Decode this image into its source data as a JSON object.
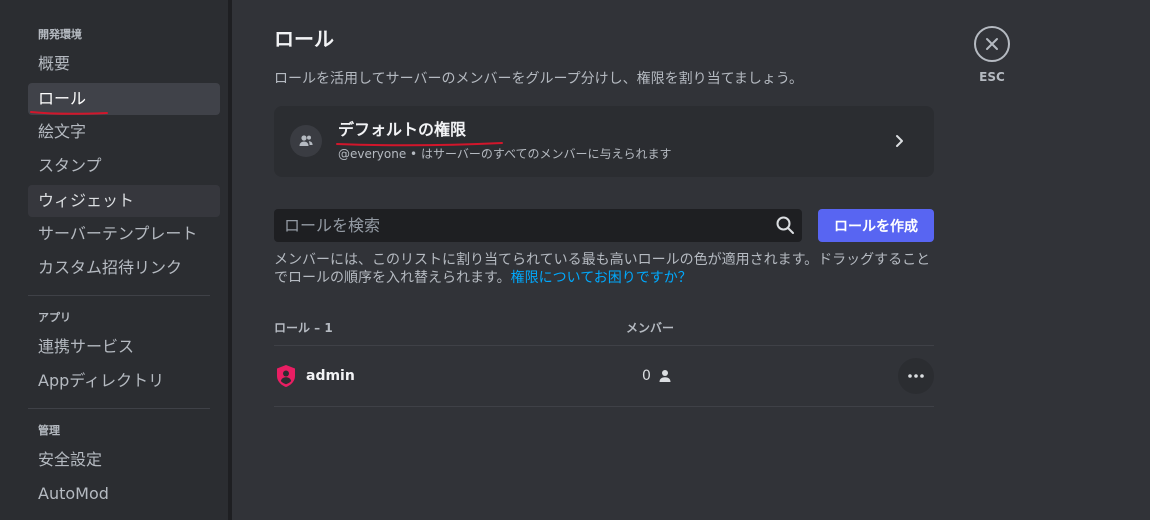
{
  "sidebar": {
    "sections": [
      {
        "header": "開発環境",
        "items": [
          {
            "label": "概要"
          },
          {
            "label": "ロール"
          },
          {
            "label": "絵文字"
          },
          {
            "label": "スタンプ"
          },
          {
            "label": "ウィジェット"
          },
          {
            "label": "サーバーテンプレート"
          },
          {
            "label": "カスタム招待リンク"
          }
        ]
      },
      {
        "header": "アプリ",
        "items": [
          {
            "label": "連携サービス"
          },
          {
            "label": "Appディレクトリ"
          }
        ]
      },
      {
        "header": "管理",
        "items": [
          {
            "label": "安全設定"
          },
          {
            "label": "AutoMod"
          }
        ]
      }
    ],
    "selected_item": "ロール",
    "hovered_item": "ウィジェット"
  },
  "main": {
    "title": "ロール",
    "description": "ロールを活用してサーバーのメンバーをグループ分けし、権限を割り当てましょう。",
    "default_permissions": {
      "title": "デフォルトの権限",
      "subtitle": "@everyone • はサーバーのすべてのメンバーに与えられます"
    },
    "search": {
      "placeholder": "ロールを検索",
      "value": ""
    },
    "create_button": "ロールを作成",
    "info": {
      "text": "メンバーには、このリストに割り当てられている最も高いロールの色が適用されます。ドラッグすることでロールの順序を入れ替えられます。",
      "link": "権限についてお困りですか？"
    },
    "table": {
      "headers": {
        "roles": "ロール – 1",
        "members": "メンバー"
      },
      "rows": [
        {
          "name": "admin",
          "members": "0"
        }
      ]
    },
    "close": {
      "label": "ESC"
    }
  },
  "colors": {
    "accent": "#5865f2",
    "link": "#00a8fc",
    "role_admin": "#e91e63",
    "annotation_red": "#d2162b"
  }
}
